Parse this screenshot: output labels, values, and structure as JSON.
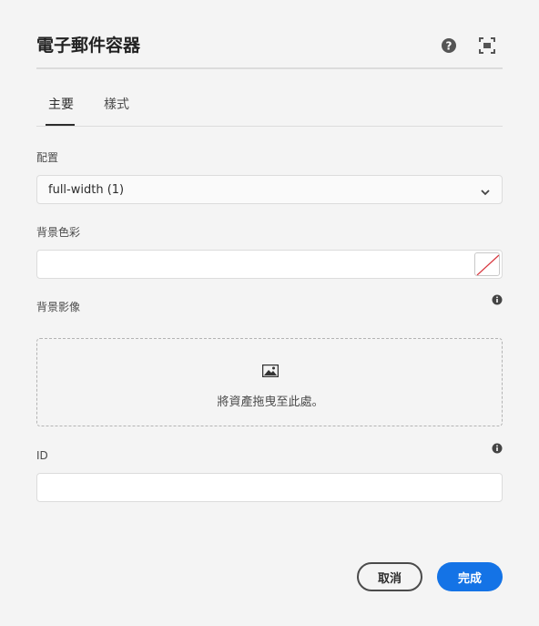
{
  "dialog": {
    "title": "電子郵件容器",
    "header_icons": [
      "help-icon",
      "fullscreen-icon"
    ]
  },
  "tabs": [
    {
      "label": "主要",
      "active": true
    },
    {
      "label": "樣式",
      "active": false
    }
  ],
  "fields": {
    "layout": {
      "label": "配置",
      "value": "full-width (1)"
    },
    "bg_color": {
      "label": "背景色彩",
      "value": ""
    },
    "bg_image": {
      "label": "背景影像",
      "drop_text": "將資產拖曳至此處。"
    },
    "id": {
      "label": "ID",
      "value": ""
    }
  },
  "buttons": {
    "cancel": "取消",
    "done": "完成"
  },
  "colors": {
    "accent": "#1473e6",
    "background": "#f4f4f4"
  }
}
